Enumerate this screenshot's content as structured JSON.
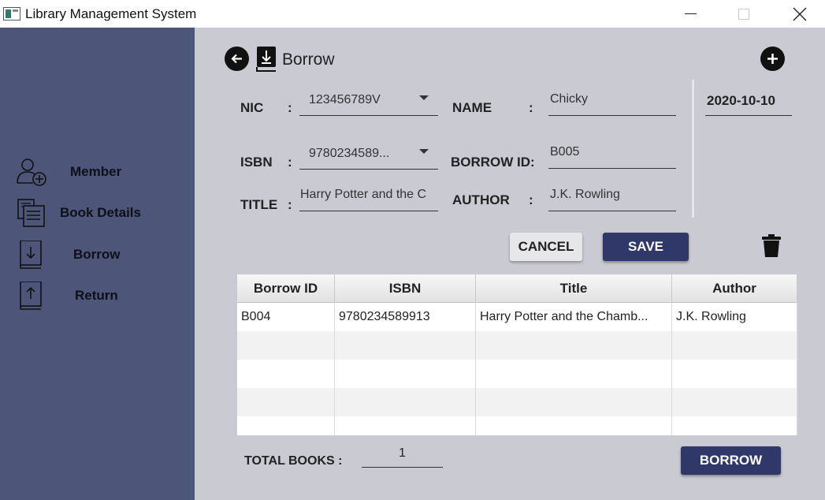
{
  "window": {
    "title": "Library Management System"
  },
  "sidebar": {
    "items": [
      {
        "label": "Member",
        "icon": "member-add-icon"
      },
      {
        "label": "Book Details",
        "icon": "book-details-icon"
      },
      {
        "label": "Borrow",
        "icon": "borrow-book-icon"
      },
      {
        "label": "Return",
        "icon": "return-book-icon"
      }
    ]
  },
  "header": {
    "title": "Borrow",
    "date": "2020-10-10"
  },
  "form": {
    "nic_label": "NIC",
    "nic_value": "123456789V",
    "name_label": "NAME",
    "name_value": "Chicky",
    "isbn_label": "ISBN",
    "isbn_value": "9780234589...",
    "borrow_id_label": "BORROW ID:",
    "borrow_id_value": "B005",
    "title_label": "TITLE",
    "title_value": "Harry Potter and the C",
    "author_label": "AUTHOR",
    "author_value": "J.K. Rowling",
    "colon": ":"
  },
  "actions": {
    "cancel_label": "CANCEL",
    "save_label": "SAVE",
    "borrow_label": "BORROW"
  },
  "table": {
    "columns": [
      "Borrow ID",
      "ISBN",
      "Title",
      "Author"
    ],
    "rows": [
      [
        "B004",
        "9780234589913",
        "Harry Potter and the Chamb...",
        "J.K. Rowling"
      ]
    ]
  },
  "footer": {
    "total_label": "TOTAL BOOKS :",
    "total_value": "1"
  },
  "colors": {
    "sidebar": "#4d5678",
    "main_bg": "#c9cad2",
    "primary_button": "#2f3868"
  }
}
